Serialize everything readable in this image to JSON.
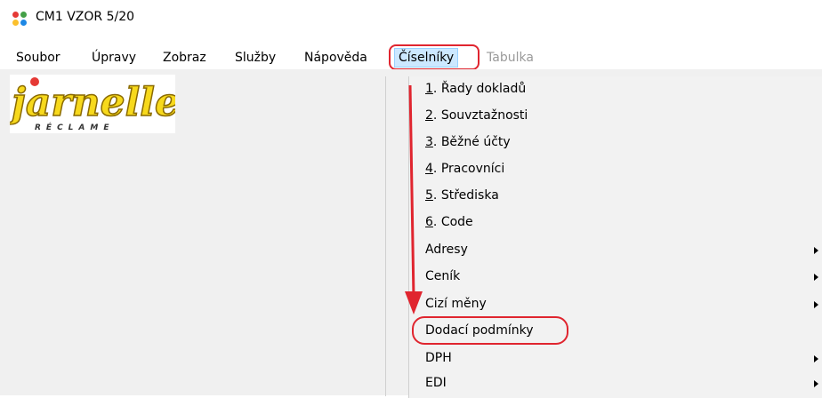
{
  "window": {
    "title": "CM1 VZOR 5/20"
  },
  "menubar": {
    "items": [
      "Soubor",
      "Úpravy",
      "Zobraz",
      "Služby",
      "Nápověda",
      "Číselníky",
      "Tabulka"
    ]
  },
  "dropdown": {
    "numbered": [
      {
        "num": "1",
        "text": ". Řady dokladů"
      },
      {
        "num": "2",
        "text": ". Souvztažnosti"
      },
      {
        "num": "3",
        "text": ". Běžné účty"
      },
      {
        "num": "4",
        "text": ". Pracovníci"
      },
      {
        "num": "5",
        "text": ". Střediska"
      },
      {
        "num": "6",
        "text": ". Code"
      }
    ],
    "items": [
      "Adresy",
      "Ceník",
      "Cizí měny",
      "Dodací podmínky",
      "DPH",
      "EDI"
    ]
  },
  "logo": {
    "brand": "jarnelle",
    "tagline": "R É C L A M E"
  },
  "colors": {
    "menu_active_bg": "#cce8ff",
    "annotation": "#e0252f",
    "menu_bg": "#f2f2f2"
  }
}
